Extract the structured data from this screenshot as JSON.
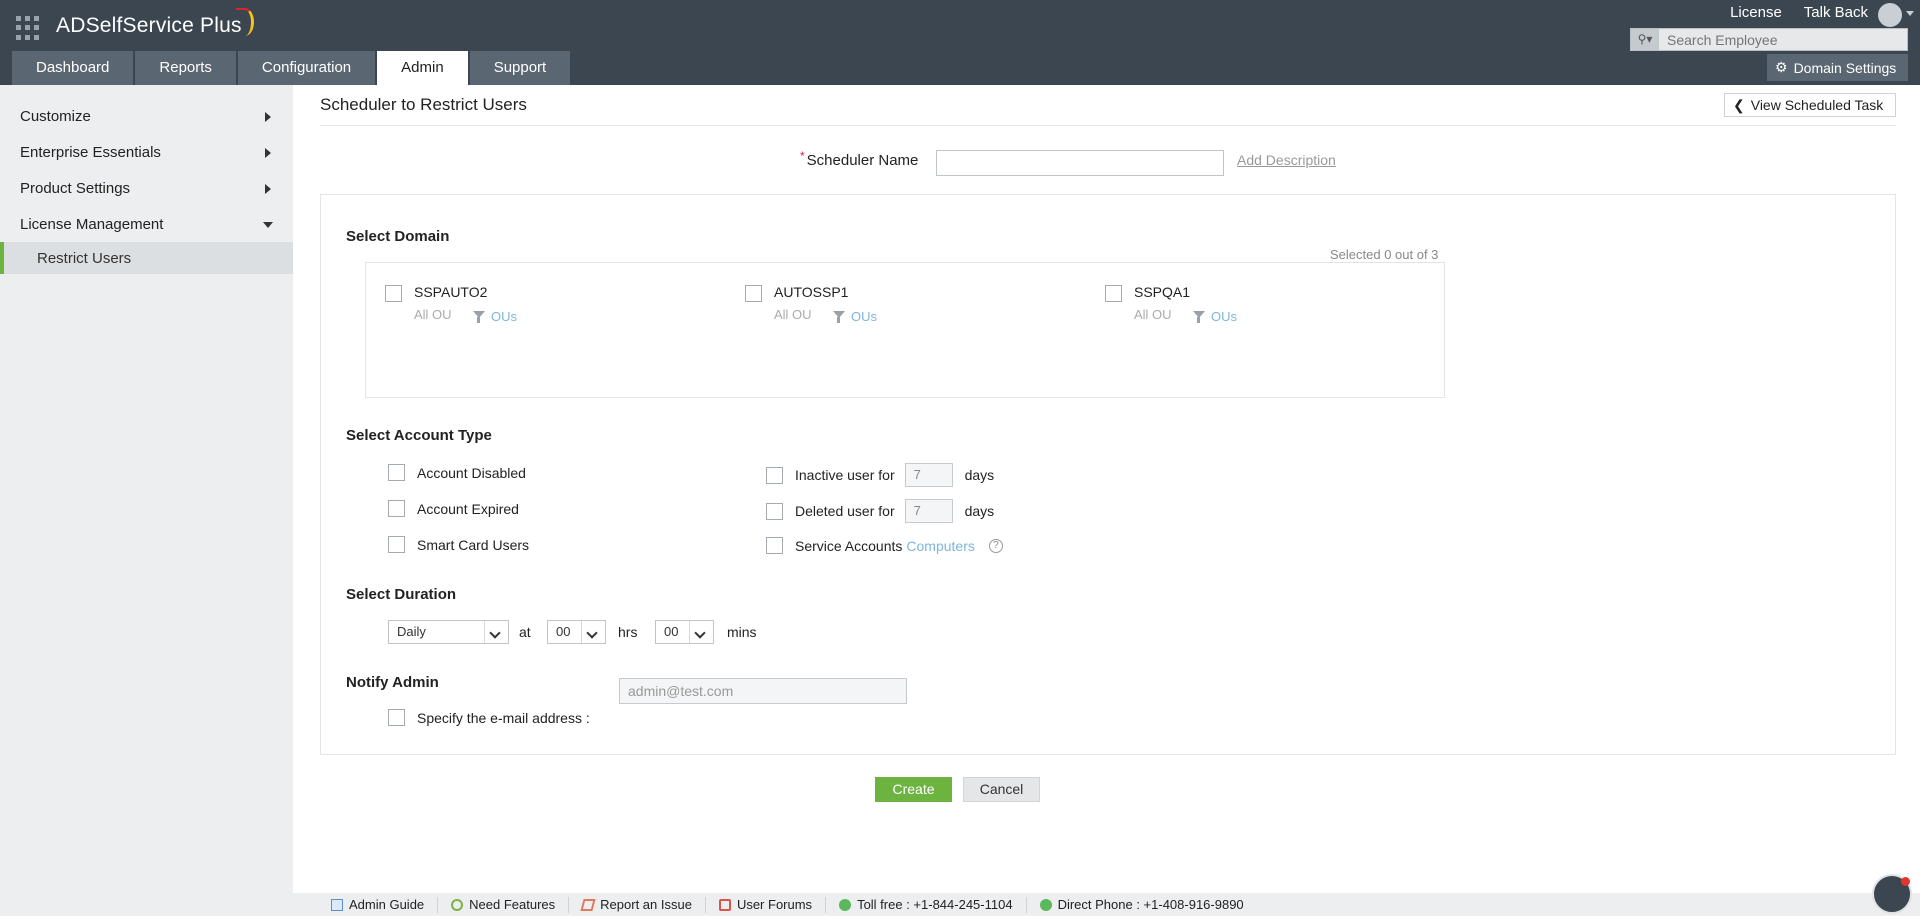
{
  "app": {
    "name": "ADSelfService Plus"
  },
  "top_links": [
    "License",
    "Talk Back"
  ],
  "search": {
    "placeholder": "Search Employee"
  },
  "tabs": [
    {
      "label": "Dashboard",
      "active": false
    },
    {
      "label": "Reports",
      "active": false
    },
    {
      "label": "Configuration",
      "active": false
    },
    {
      "label": "Admin",
      "active": true
    },
    {
      "label": "Support",
      "active": false
    }
  ],
  "domain_settings_label": "Domain Settings",
  "sidebar": {
    "items": [
      {
        "label": "Customize",
        "expanded": false
      },
      {
        "label": "Enterprise Essentials",
        "expanded": false
      },
      {
        "label": "Product Settings",
        "expanded": false
      },
      {
        "label": "License Management",
        "expanded": true
      }
    ],
    "sub_items": [
      {
        "label": "Restrict Users",
        "selected": true
      }
    ]
  },
  "page": {
    "title": "Scheduler to Restrict Users",
    "view_task_label": "View Scheduled Task",
    "scheduler_name_label": "Scheduler Name",
    "required_mark": "*",
    "scheduler_name_value": "",
    "add_description_label": "Add Description"
  },
  "select_domain": {
    "title": "Select Domain",
    "selected_count": "Selected 0 out of 3",
    "domains": [
      {
        "name": "SSPAUTO2",
        "scope": "All OU",
        "ous_label": "OUs",
        "checked": false
      },
      {
        "name": "AUTOSSP1",
        "scope": "All OU",
        "ous_label": "OUs",
        "checked": false
      },
      {
        "name": "SSPQA1",
        "scope": "All OU",
        "ous_label": "OUs",
        "checked": false
      }
    ]
  },
  "account_type": {
    "title": "Select Account Type",
    "left": [
      {
        "label": "Account Disabled",
        "checked": false
      },
      {
        "label": "Account Expired",
        "checked": false
      },
      {
        "label": "Smart Card Users",
        "checked": false
      }
    ],
    "inactive": {
      "label": "Inactive user for",
      "value": "7",
      "unit": "days"
    },
    "deleted": {
      "label": "Deleted user for",
      "value": "7",
      "unit": "days"
    },
    "service": {
      "label": "Service Accounts",
      "link": "Computers",
      "help": "?"
    }
  },
  "duration": {
    "title": "Select Duration",
    "frequency": "Daily",
    "at_label": "at",
    "hours": "00",
    "hrs_label": "hrs",
    "minutes": "00",
    "mins_label": "mins"
  },
  "notify": {
    "title": "Notify Admin",
    "label": "Specify the e-mail address :",
    "placeholder": "admin@test.com"
  },
  "buttons": {
    "create": "Create",
    "cancel": "Cancel"
  },
  "footer": [
    {
      "label": "Admin Guide",
      "icon": "book-icon"
    },
    {
      "label": "Need Features",
      "icon": "bulb-icon"
    },
    {
      "label": "Report an Issue",
      "icon": "ticket-icon"
    },
    {
      "label": "User Forums",
      "icon": "forum-icon"
    },
    {
      "label": "Toll free : +1-844-245-1104",
      "icon": "phone-icon"
    },
    {
      "label": "Direct Phone : +1-408-916-9890",
      "icon": "phone-icon"
    }
  ],
  "colors": {
    "header": "#3b4650",
    "tab": "#5a6672",
    "accent_green": "#6cb33f",
    "link_blue": "#7db6de"
  }
}
